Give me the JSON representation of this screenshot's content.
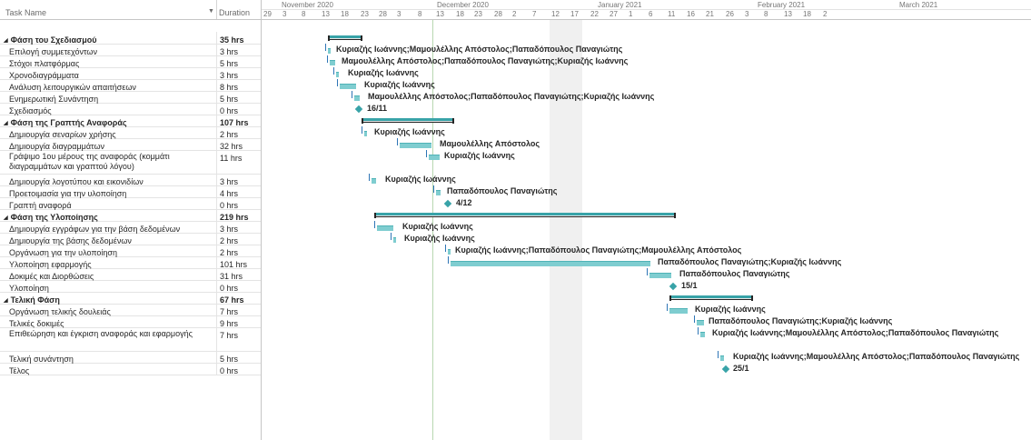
{
  "grid": {
    "header": {
      "task_name": "Task Name",
      "sort_icon": "sort-down-arrow",
      "duration": "Duration"
    },
    "rows": [
      {
        "name": "Φάση του Σχεδιασμού",
        "duration": "35 hrs",
        "summary": true
      },
      {
        "name": "Επιλογή συμμετεχόντων",
        "duration": "3 hrs"
      },
      {
        "name": "Στόχοι πλατφόρμας",
        "duration": "5 hrs"
      },
      {
        "name": "Χρονοδιαγράμματα",
        "duration": "3 hrs"
      },
      {
        "name": "Ανάλυση λειτουργικών απαιτήσεων",
        "duration": "8 hrs"
      },
      {
        "name": "Ενημερωτική Συνάντηση",
        "duration": "5 hrs"
      },
      {
        "name": "Σχεδιασμός",
        "duration": "0 hrs"
      },
      {
        "name": "Φάση της Γραπτής Αναφοράς",
        "duration": "107 hrs",
        "summary": true
      },
      {
        "name": "Δημιουργία σεναρίων χρήσης",
        "duration": "2 hrs"
      },
      {
        "name": "Δημιουργία διαγραμμάτων",
        "duration": "32 hrs"
      },
      {
        "name": "Γράψιμο 1ου μέρους της αναφοράς (κομμάτι διαγραμμάτων και γραπτού λόγου)",
        "duration": "11 hrs",
        "tall": true
      },
      {
        "name": "Δημιουργία λογοτύπου και εικονιδίων",
        "duration": "3 hrs"
      },
      {
        "name": "Προετοιμασία για την υλοποίηση",
        "duration": "4 hrs"
      },
      {
        "name": "Γραπτή αναφορά",
        "duration": "0 hrs"
      },
      {
        "name": "Φάση της Υλοποίησης",
        "duration": "219 hrs",
        "summary": true
      },
      {
        "name": "Δημιουργία εγγράφων για την βάση δεδομένων",
        "duration": "3 hrs"
      },
      {
        "name": "Δημιουργία της βάσης δεδομένων",
        "duration": "2 hrs"
      },
      {
        "name": "Οργάνωση για την υλοποίηση",
        "duration": "2 hrs"
      },
      {
        "name": "Υλοποίηση εφαρμογής",
        "duration": "101 hrs"
      },
      {
        "name": "Δοκιμές και Διορθώσεις",
        "duration": "31 hrs"
      },
      {
        "name": "Υλοποίηση",
        "duration": "0 hrs"
      },
      {
        "name": "Τελική Φάση",
        "duration": "67 hrs",
        "summary": true
      },
      {
        "name": "Οργάνωση τελικής δουλειάς",
        "duration": "7 hrs"
      },
      {
        "name": "Τελικές δοκιμές",
        "duration": "9 hrs"
      },
      {
        "name": "Επιθεώρηση και έγκριση αναφοράς και εφαρμογής",
        "duration": "7 hrs",
        "tall": true
      },
      {
        "name": "Τελική συνάντηση",
        "duration": "5 hrs"
      },
      {
        "name": "Τέλος",
        "duration": "0 hrs"
      }
    ]
  },
  "timeline": {
    "months": [
      "November 2020",
      "December 2020",
      "January 2021",
      "February 2021",
      "March 2021"
    ],
    "days": [
      "29",
      "3",
      "8",
      "13",
      "18",
      "23",
      "28",
      "3",
      "8",
      "13",
      "18",
      "23",
      "28",
      "2",
      "7",
      "12",
      "17",
      "22",
      "27",
      "1",
      "6",
      "11",
      "16",
      "21",
      "26",
      "3",
      "8",
      "13",
      "18",
      "2"
    ]
  },
  "gantt": {
    "colors": {
      "bar": "#7fcdd0",
      "summary_fill": "#38a3a8",
      "milestone": "#38a3a8",
      "link": "#2e75b6",
      "status_line": "#b7d7b0"
    },
    "items": [
      {
        "kind": "summary",
        "label": ""
      },
      {
        "kind": "bar",
        "label": "Κυριαζής Ιωάννης;Μαμουλέλλης Απόστολος;Παπαδόπουλος Παναγιώτης"
      },
      {
        "kind": "bar",
        "label": "Μαμουλέλλης Απόστολος;Παπαδόπουλος Παναγιώτης;Κυριαζής Ιωάννης"
      },
      {
        "kind": "bar",
        "label": "Κυριαζής Ιωάννης"
      },
      {
        "kind": "bar",
        "label": "Κυριαζής Ιωάννης"
      },
      {
        "kind": "bar",
        "label": "Μαμουλέλλης Απόστολος;Παπαδόπουλος Παναγιώτης;Κυριαζής Ιωάννης"
      },
      {
        "kind": "milestone",
        "label": "16/11"
      },
      {
        "kind": "summary",
        "label": ""
      },
      {
        "kind": "bar",
        "label": "Κυριαζής Ιωάννης"
      },
      {
        "kind": "bar",
        "label": "Μαμουλέλλης Απόστολος"
      },
      {
        "kind": "bar",
        "label": "Κυριαζής Ιωάννης"
      },
      {
        "kind": "bar",
        "label": "Κυριαζής Ιωάννης"
      },
      {
        "kind": "bar",
        "label": "Παπαδόπουλος Παναγιώτης"
      },
      {
        "kind": "milestone",
        "label": "4/12"
      },
      {
        "kind": "summary",
        "label": ""
      },
      {
        "kind": "bar",
        "label": "Κυριαζής Ιωάννης"
      },
      {
        "kind": "bar",
        "label": "Κυριαζής Ιωάννης"
      },
      {
        "kind": "bar",
        "label": "Κυριαζής Ιωάννης;Παπαδόπουλος Παναγιώτης;Μαμουλέλλης Απόστολος"
      },
      {
        "kind": "bar",
        "label": "Παπαδόπουλος Παναγιώτης;Κυριαζής Ιωάννης"
      },
      {
        "kind": "bar",
        "label": "Παπαδόπουλος Παναγιώτης"
      },
      {
        "kind": "milestone",
        "label": "15/1"
      },
      {
        "kind": "summary",
        "label": ""
      },
      {
        "kind": "bar",
        "label": "Κυριαζής Ιωάννης"
      },
      {
        "kind": "bar",
        "label": "Παπαδόπουλος Παναγιώτης;Κυριαζής Ιωάννης"
      },
      {
        "kind": "bar",
        "label": "Κυριαζής Ιωάννης;Μαμουλέλλης Απόστολος;Παπαδόπουλος Παναγιώτης"
      },
      {
        "kind": "bar",
        "label": "Κυριαζής Ιωάννης;Μαμουλέλλης Απόστολος;Παπαδόπουλος Παναγιώτης"
      },
      {
        "kind": "milestone",
        "label": "25/1"
      }
    ]
  }
}
